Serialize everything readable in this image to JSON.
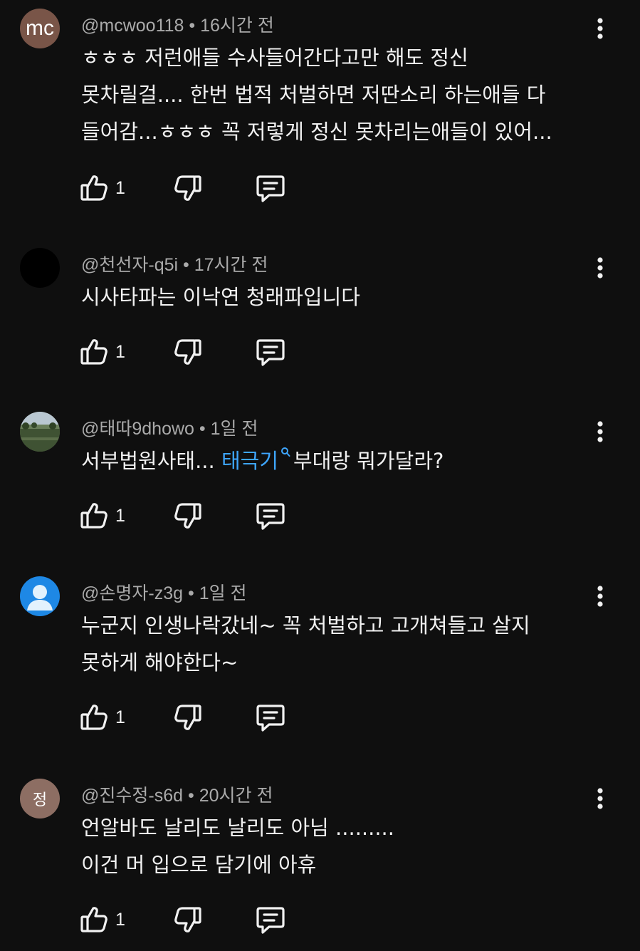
{
  "comments": [
    {
      "author": "@mcwoo118",
      "separator": "•",
      "time": "16시간 전",
      "avatar_text": "mc",
      "avatar_color": "#795548",
      "lines": [
        "ㅎㅎㅎ  저런애들   수사들어간다고만 해도  정신",
        "못차릴걸....  한번  법적 처벌하면  저딴소리 하는애들   다",
        "들어감...ㅎㅎㅎ    꼭 저렇게  정신 못차리는애들이 있어..."
      ],
      "likes": "1"
    },
    {
      "author": "@천선자-q5i",
      "separator": "•",
      "time": "17시간 전",
      "avatar_text": "",
      "avatar_color": "#000000",
      "lines": [
        "시사타파는 이낙연 청래파입니다"
      ],
      "likes": "1"
    },
    {
      "author": "@태따9dhowo",
      "separator": "•",
      "time": "1일 전",
      "avatar_text": "",
      "avatar_color": "#56604a",
      "text_before": "서부법원사태... ",
      "link_text": "태극기",
      "text_after": "부대랑 뭐가달라?",
      "likes": "1"
    },
    {
      "author": "@손명자-z3g",
      "separator": "•",
      "time": "1일 전",
      "avatar_text": "",
      "avatar_color": "#1e88e5",
      "lines": [
        "누군지 인생나락갔네~  꼭 처벌하고  고개쳐들고 살지",
        "못하게 해야한다~"
      ],
      "likes": "1"
    },
    {
      "author": "@진수정-s6d",
      "separator": "•",
      "time": "20시간 전",
      "avatar_text": "정",
      "avatar_color": "#8d6e63",
      "lines": [
        "언알바도 날리도 날리도 아님 .........",
        "이건 머 입으로 담기에 아휴"
      ],
      "likes": "1"
    }
  ],
  "icons": {
    "like": "thumb-up-icon",
    "dislike": "thumb-down-icon",
    "reply": "reply-comment-icon",
    "more": "more-vertical-icon"
  },
  "colors": {
    "background": "#0f0f0f",
    "text": "#f1f1f1",
    "meta": "#aaaaaa",
    "link": "#3ea6ff"
  }
}
